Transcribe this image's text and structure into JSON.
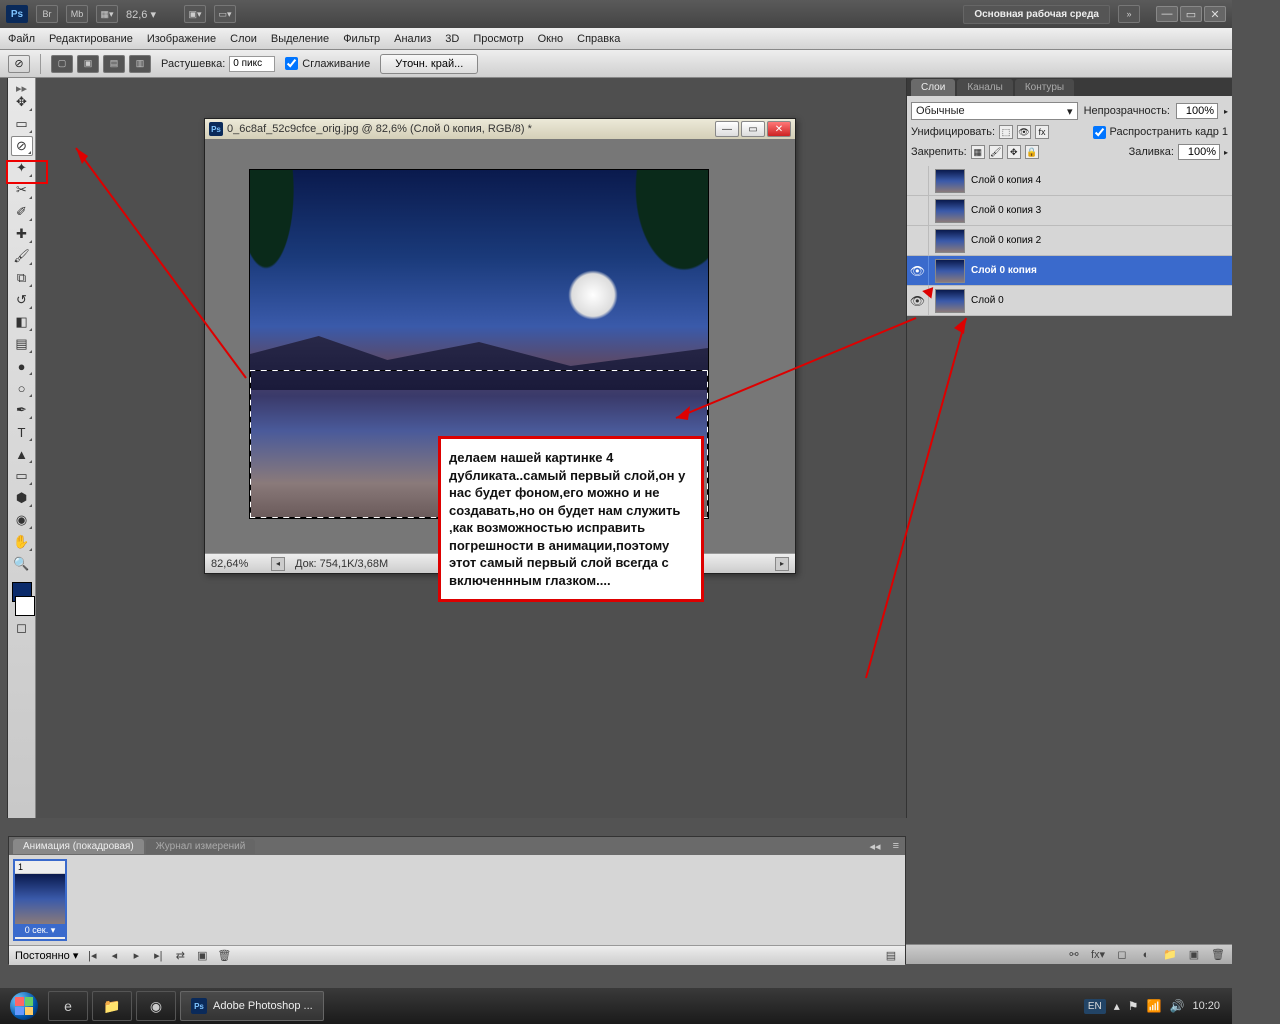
{
  "appbar": {
    "logo": "Ps",
    "buttons": {
      "br": "Br",
      "mb": "Mb"
    },
    "zoom": "82,6  ▾",
    "workspace": "Основная рабочая среда",
    "expand": "»"
  },
  "menu": [
    "Файл",
    "Редактирование",
    "Изображение",
    "Слои",
    "Выделение",
    "Фильтр",
    "Анализ",
    "3D",
    "Просмотр",
    "Окно",
    "Справка"
  ],
  "options": {
    "feather_label": "Растушевка:",
    "feather_value": "0 пикс",
    "antialias": "Сглаживание",
    "refine": "Уточн. край..."
  },
  "document": {
    "title": "0_6c8af_52c9cfce_orig.jpg @ 82,6% (Слой 0 копия, RGB/8) *",
    "status_pct": "82,64%",
    "status_doc": "Док: 754,1K/3,68M"
  },
  "annotation": "делаем нашей картинке 4 дубликата..самый первый слой,он у нас будет фоном,его можно и не создавать,но он будет нам служить ,как возможностью исправить погрешности в анимации,поэтому этот самый первый слой всегда с включеннным глазком....",
  "layers_panel": {
    "tabs": [
      "Слои",
      "Каналы",
      "Контуры"
    ],
    "blend_mode": "Обычные",
    "opacity_label": "Непрозрачность:",
    "opacity": "100%",
    "unify_label": "Унифицировать:",
    "propagate": "Распространить кадр 1",
    "lock_label": "Закрепить:",
    "fill_label": "Заливка:",
    "fill": "100%",
    "layers": [
      {
        "name": "Слой 0 копия 4",
        "visible": false,
        "selected": false
      },
      {
        "name": "Слой 0 копия 3",
        "visible": false,
        "selected": false
      },
      {
        "name": "Слой 0 копия 2",
        "visible": false,
        "selected": false
      },
      {
        "name": "Слой 0 копия",
        "visible": true,
        "selected": true
      },
      {
        "name": "Слой 0",
        "visible": true,
        "selected": false
      }
    ]
  },
  "animation_panel": {
    "tabs": [
      "Анимация (покадровая)",
      "Журнал измерений"
    ],
    "frame_num": "1",
    "frame_time": "0 сек. ▾",
    "loop": "Постоянно ▾"
  },
  "taskbar": {
    "app": "Adobe Photoshop ...",
    "lang": "EN",
    "time": "10:20"
  }
}
